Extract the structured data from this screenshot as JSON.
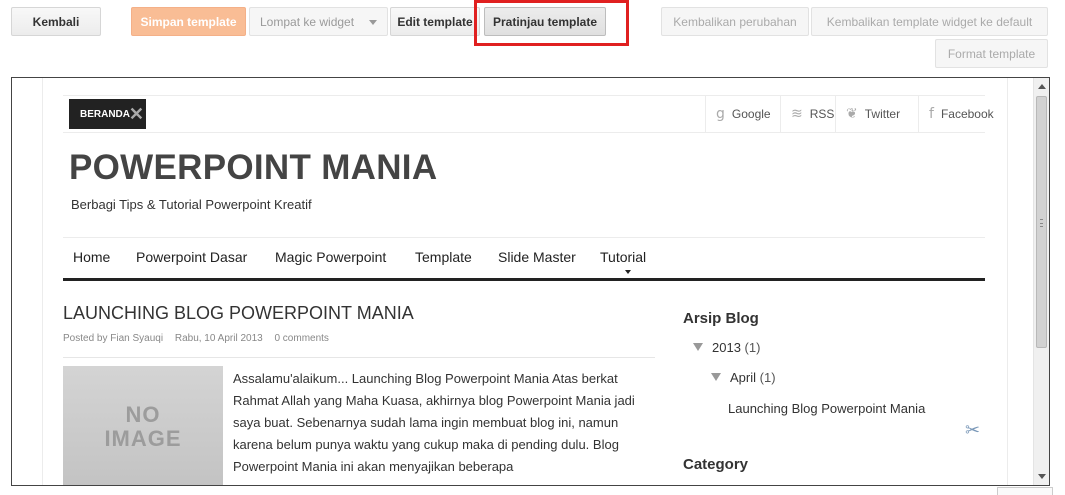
{
  "toolbar": {
    "back": "Kembali",
    "save": "Simpan template",
    "jump": "Lompat ke widget",
    "edit": "Edit template",
    "preview": "Pratinjau template",
    "revert": "Kembalikan perubahan",
    "revert_default": "Kembalikan template widget ke default",
    "format": "Format template"
  },
  "colors": {
    "highlight": "#e02020",
    "save_button": "#f9bd95"
  },
  "blog": {
    "home_badge": "BERANDA",
    "social": [
      {
        "icon": "google-icon",
        "label": "Google"
      },
      {
        "icon": "rss-icon",
        "label": "RSS"
      },
      {
        "icon": "twitter-icon",
        "label": "Twitter"
      },
      {
        "icon": "facebook-icon",
        "label": "Facebook"
      }
    ],
    "title": "POWERPOINT MANIA",
    "description": "Berbagi Tips & Tutorial Powerpoint Kreatif",
    "nav": [
      "Home",
      "Powerpoint Dasar",
      "Magic Powerpoint",
      "Template",
      "Slide Master",
      "Tutorial"
    ],
    "post": {
      "title": "LAUNCHING BLOG POWERPOINT MANIA",
      "meta_author": "Posted by Fian Syauqi",
      "meta_date": "Rabu, 10 April 2013",
      "meta_comments": "0 comments",
      "image_text_1": "NO",
      "image_text_2": "IMAGE",
      "body": "Assalamu'alaikum... Launching Blog Powerpoint Mania Atas berkat Rahmat Allah yang Maha Kuasa, akhirnya blog Powerpoint Mania jadi saya buat. Sebenarnya sudah lama ingin membuat blog ini, namun karena belum punya waktu yang cukup maka di pending dulu. Blog Powerpoint Mania ini akan menyajikan beberapa"
    },
    "sidebar": {
      "archive_title": "Arsip Blog",
      "year": "2013",
      "year_count": "(1)",
      "month": "April",
      "month_count": "(1)",
      "post_link": "Launching Blog Powerpoint Mania",
      "category_title": "Category"
    }
  }
}
